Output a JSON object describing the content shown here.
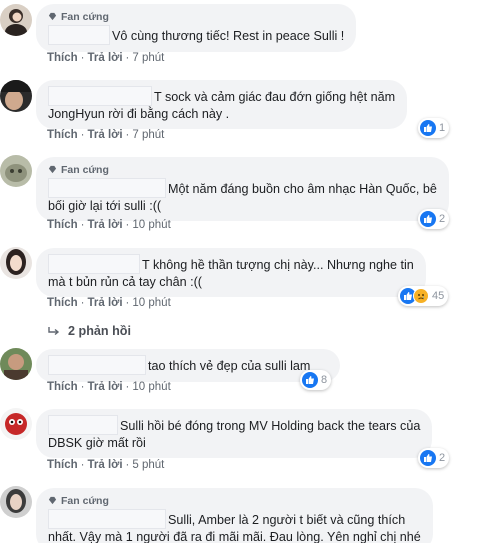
{
  "colors": {
    "bubble": "#f2f3f5",
    "like_blue": "#1877f2",
    "sad_yellow": "#f7b125",
    "meta_gray": "#606770"
  },
  "actions": {
    "like": "Thích",
    "reply": "Trả lời",
    "sep": "·"
  },
  "fan_badge": "Fan cứng",
  "comments": [
    {
      "text": "Vô cùng thương tiếc! Rest in peace Sulli !",
      "time": "7 phút"
    },
    {
      "line1": "T sock và cảm giác đau đớn giống hệt năm",
      "line2": "JongHyun rời đi bằng cách này .",
      "time": "7 phút",
      "reactions": "1"
    },
    {
      "line1": "Một năm đáng buồn cho âm nhạc Hàn Quốc, bê",
      "line2": "bối giờ lại tới sulli :((",
      "time": "10 phút",
      "reactions": "2"
    },
    {
      "line1": "T không hề thần tượng chị này... Nhưng nghe tin",
      "line2": "mà t bủn rủn cả tay chân :((",
      "time": "10 phút",
      "reactions": "45"
    },
    {
      "text": "tao thích vẻ đẹp của sulli lam",
      "time": "10 phút",
      "reactions": "8"
    },
    {
      "line1": "Sulli hồi bé đóng trong MV Holding back the tears của",
      "line2": "DBSK giờ mất rồi",
      "time": "5 phút",
      "reactions": "2"
    },
    {
      "line1": "Sulli, Amber là 2 người t biết và cũng thích",
      "line2": "nhất. Vậy mà 1 người đã ra đi mãi mãi. Đau lòng. Yên nghỉ chị nhé"
    }
  ],
  "replies_label": "2 phản hồi",
  "reaction_icons": [
    "like-icon",
    "sad-icon"
  ]
}
